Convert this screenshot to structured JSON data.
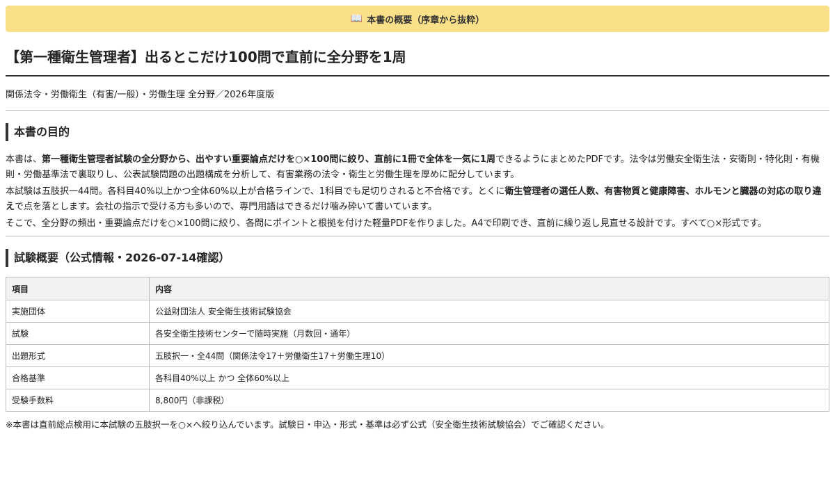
{
  "banner": {
    "icon": "open-book-icon",
    "text": "本書の概要（序章から抜粋）"
  },
  "title": "【第一種衛生管理者】出るとこだけ100問で直前に全分野を1周",
  "subtitle": "関係法令・労働衛生（有害/一般）・労働生理 全分野／2026年度版",
  "purpose": {
    "heading": "本書の目的",
    "p1": {
      "pre": "本書は、",
      "bold": "第一種衛生管理者試験の全分野から、出やすい重要論点だけを○×100問に絞り、直前に1冊で全体を一気に1周",
      "post": "できるようにまとめたPDFです。法令は労働安全衛生法・安衛則・特化則・有機則・労働基準法で裏取りし、公表試験問題の出題構成を分析して、有害業務の法令・衛生と労働生理を厚めに配分しています。"
    },
    "p2": {
      "pre": "本試験は五肢択一44問。各科目40%以上かつ全体60%以上が合格ラインで、1科目でも足切りされると不合格です。とくに",
      "bold": "衛生管理者の選任人数、有害物質と健康障害、ホルモンと臓器の対応の取り違え",
      "post": "で点を落とします。会社の指示で受ける方も多いので、専門用語はできるだけ噛み砕いて書いています。"
    },
    "p3": "そこで、全分野の頻出・重要論点だけを○×100問に絞り、各問にポイントと根拠を付けた軽量PDFを作りました。A4で印刷でき、直前に繰り返し見直せる設計です。すべて○×形式です。"
  },
  "exam": {
    "heading": "試験概要（公式情報・2026-07-14確認）",
    "columns": [
      "項目",
      "内容"
    ],
    "rows": [
      [
        "実施団体",
        "公益財団法人 安全衛生技術試験協会"
      ],
      [
        "試験",
        "各安全衛生技術センターで随時実施（月数回・通年）"
      ],
      [
        "出題形式",
        "五肢択一・全44問（関係法令17＋労働衛生17＋労働生理10）"
      ],
      [
        "合格基準",
        "各科目40%以上 かつ 全体60%以上"
      ],
      [
        "受験手数料",
        "8,800円（非課税）"
      ]
    ],
    "note": "※本書は直前総点検用に本試験の五肢択一を○×へ絞り込んでいます。試験日・申込・形式・基準は必ず公式（安全衛生技術試験協会）でご確認ください。"
  }
}
